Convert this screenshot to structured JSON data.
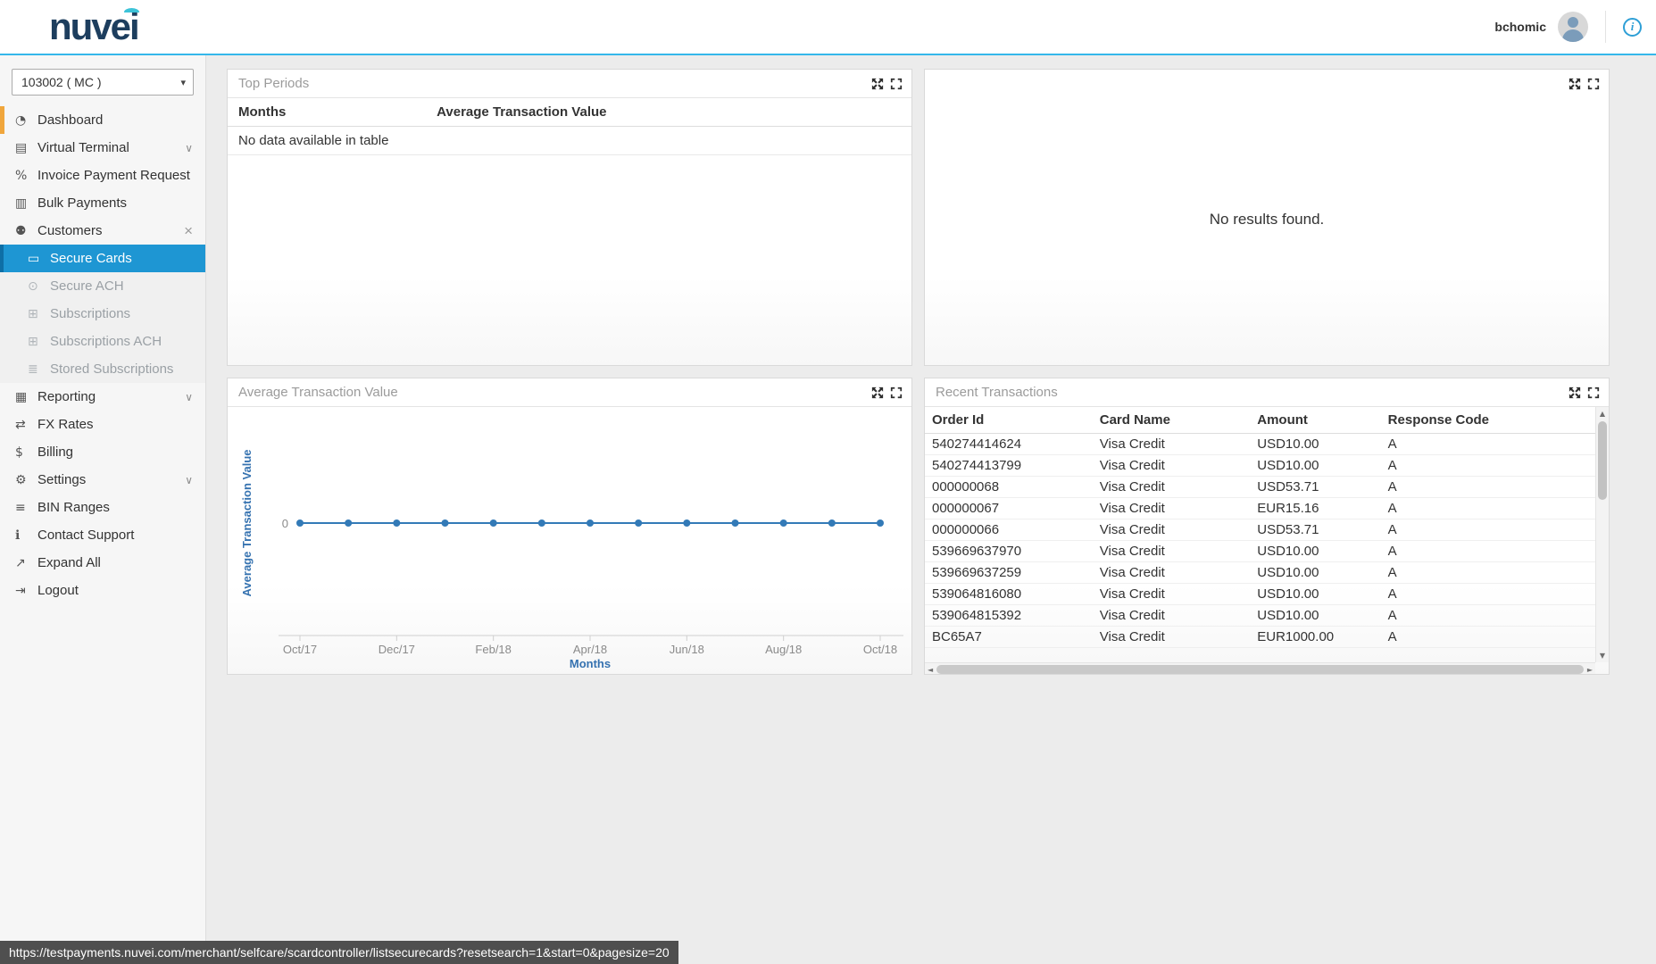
{
  "header": {
    "logo": "nuvei",
    "username": "bchomic"
  },
  "sidebar": {
    "merchant_select": {
      "value": "103002 ( MC )"
    },
    "items": [
      {
        "label": "Dashboard",
        "icon": "dashboard-icon",
        "accent": true
      },
      {
        "label": "Virtual Terminal",
        "icon": "virtual-terminal-icon",
        "chevron": true
      },
      {
        "label": "Invoice Payment Request",
        "icon": "invoice-payment-request-icon"
      },
      {
        "label": "Bulk Payments",
        "icon": "bulk-payments-icon"
      },
      {
        "label": "Customers",
        "icon": "customers-icon",
        "close": true
      },
      {
        "label": "Secure Cards",
        "icon": "secure-cards-icon",
        "child": true,
        "selected": true
      },
      {
        "label": "Secure ACH",
        "icon": "secure-ach-icon",
        "child": true,
        "muted": true
      },
      {
        "label": "Subscriptions",
        "icon": "subscriptions-icon",
        "child": true,
        "muted": true
      },
      {
        "label": "Subscriptions ACH",
        "icon": "subscriptions-ach-icon",
        "child": true,
        "muted": true
      },
      {
        "label": "Stored Subscriptions",
        "icon": "stored-subscriptions-icon",
        "child": true,
        "muted": true
      },
      {
        "label": "Reporting",
        "icon": "reporting-icon",
        "chevron": true
      },
      {
        "label": "FX Rates",
        "icon": "fx-rates-icon"
      },
      {
        "label": "Billing",
        "icon": "billing-icon"
      },
      {
        "label": "Settings",
        "icon": "settings-icon",
        "chevron": true
      },
      {
        "label": "BIN Ranges",
        "icon": "bin-ranges-icon"
      },
      {
        "label": "Contact Support",
        "icon": "contact-support-icon"
      },
      {
        "label": "Expand All",
        "icon": "expand-all-icon"
      },
      {
        "label": "Logout",
        "icon": "logout-icon"
      }
    ]
  },
  "panels": {
    "top_periods": {
      "title": "Top Periods",
      "columns": [
        "Months",
        "Average Transaction Value"
      ],
      "empty_text": "No data available in table"
    },
    "results_panel": {
      "empty_text": "No results found."
    },
    "avg_transaction_value": {
      "title": "Average Transaction Value"
    },
    "recent_transactions": {
      "title": "Recent Transactions",
      "columns": [
        "Order Id",
        "Card Name",
        "Amount",
        "Response Code"
      ],
      "rows": [
        [
          "540274414624",
          "Visa Credit",
          "USD10.00",
          "A"
        ],
        [
          "540274413799",
          "Visa Credit",
          "USD10.00",
          "A"
        ],
        [
          "000000068",
          "Visa Credit",
          "USD53.71",
          "A"
        ],
        [
          "000000067",
          "Visa Credit",
          "EUR15.16",
          "A"
        ],
        [
          "000000066",
          "Visa Credit",
          "USD53.71",
          "A"
        ],
        [
          "539669637970",
          "Visa Credit",
          "USD10.00",
          "A"
        ],
        [
          "539669637259",
          "Visa Credit",
          "USD10.00",
          "A"
        ],
        [
          "539064816080",
          "Visa Credit",
          "USD10.00",
          "A"
        ],
        [
          "539064815392",
          "Visa Credit",
          "USD10.00",
          "A"
        ],
        [
          "BC65A7",
          "Visa Credit",
          "EUR1000.00",
          "A"
        ]
      ]
    },
    "control_icons": [
      "arrows-out-icon",
      "fullscreen-icon"
    ]
  },
  "chart_data": {
    "type": "line",
    "title": "Average Transaction Value",
    "x": [
      "Oct/17",
      "Nov/17",
      "Dec/17",
      "Jan/18",
      "Feb/18",
      "Mar/18",
      "Apr/18",
      "May/18",
      "Jun/18",
      "Jul/18",
      "Aug/18",
      "Sep/18",
      "Oct/18"
    ],
    "values": [
      0,
      0,
      0,
      0,
      0,
      0,
      0,
      0,
      0,
      0,
      0,
      0,
      0
    ],
    "tick_labels": [
      "Oct/17",
      "Dec/17",
      "Feb/18",
      "Apr/18",
      "Jun/18",
      "Aug/18",
      "Oct/18"
    ],
    "y_ticks": [
      0
    ],
    "xlabel": "Months",
    "ylabel": "Average Transaction Value",
    "grid": false,
    "legend": "none",
    "line_color": "#337ab7",
    "axis_label_color": "#3572b0",
    "tick_color": "#8a8a8a"
  },
  "status_bar": {
    "url": "https://testpayments.nuvei.com/merchant/selfcare/scardcontroller/listsecurecards?resetsearch=1&start=0&pagesize=20"
  },
  "icons": {
    "dashboard-icon": "◔",
    "virtual-terminal-icon": "▤",
    "invoice-payment-request-icon": "%",
    "bulk-payments-icon": "▥",
    "customers-icon": "⚉",
    "secure-cards-icon": "▭",
    "secure-ach-icon": "⊙",
    "subscriptions-icon": "⊞",
    "subscriptions-ach-icon": "⊞",
    "stored-subscriptions-icon": "≣",
    "reporting-icon": "▦",
    "fx-rates-icon": "⇄",
    "billing-icon": "$",
    "settings-icon": "⚙",
    "bin-ranges-icon": "≡",
    "contact-support-icon": "ℹ",
    "expand-all-icon": "↗",
    "logout-icon": "⇥",
    "chevron-down-icon": "∨",
    "close-icon": "×",
    "select-arrow-icon": "▾",
    "info-icon": "i",
    "scroll-up-icon": "▲",
    "scroll-down-icon": "▼",
    "scroll-left-icon": "◄",
    "scroll-right-icon": "►"
  },
  "colors": {
    "selected_nav_bg": "#1e96d3",
    "dashboard_accent": "#f0a63c",
    "header_underline": "#35b7ea",
    "chart_line": "#337ab7"
  }
}
